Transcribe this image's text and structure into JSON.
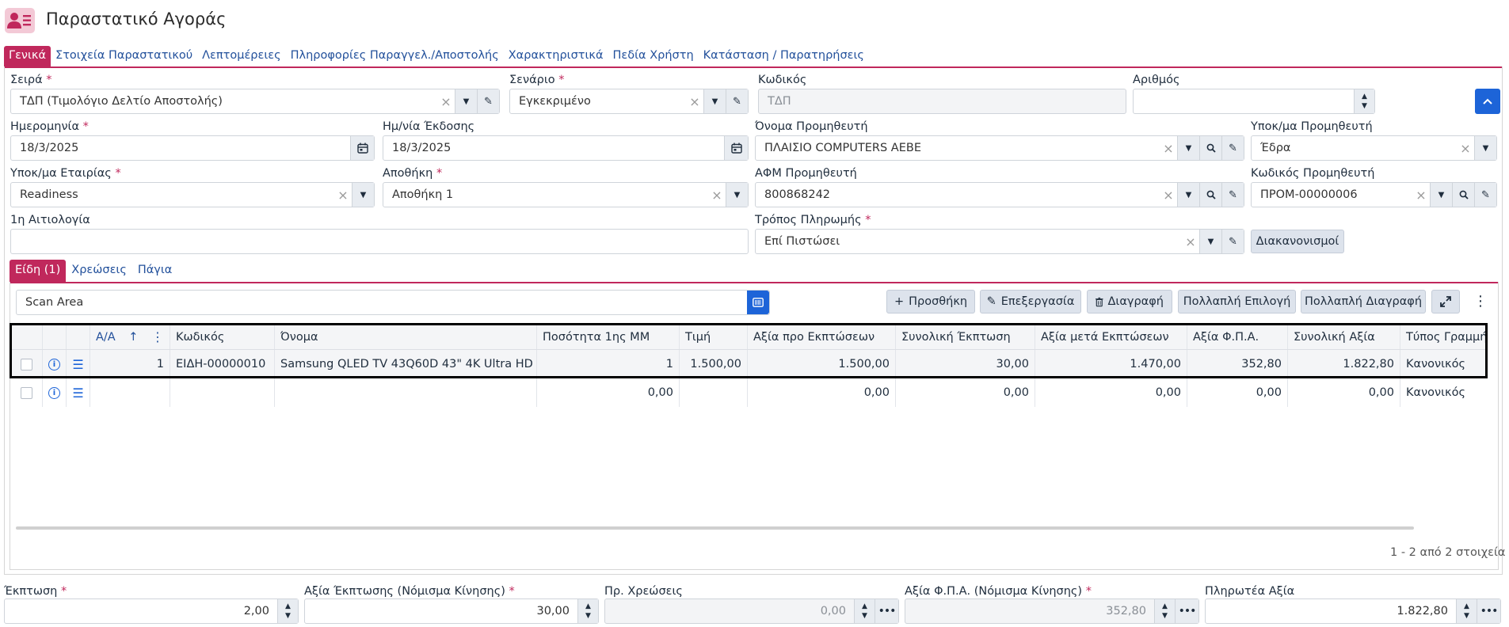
{
  "header": {
    "title": "Παραστατικό Αγοράς",
    "icon": "user-list-icon"
  },
  "tabs": [
    "Γενικά",
    "Στοιχεία Παραστατικού",
    "Λεπτομέρειες",
    "Πληροφορίες Παραγγελ./Αποστολής",
    "Χαρακτηριστικά",
    "Πεδία Χρήστη",
    "Κατάσταση / Παρατηρήσεις"
  ],
  "form": {
    "seira": {
      "label": "Σειρά",
      "value": "ΤΔΠ (Τιμολόγιο Δελτίο Αποστολής)"
    },
    "senario": {
      "label": "Σενάριο",
      "value": "Εγκεκριμένο"
    },
    "kodikos": {
      "label": "Κωδικός",
      "value": "ΤΔΠ"
    },
    "arithmos": {
      "label": "Αριθμός",
      "value": ""
    },
    "imerominia": {
      "label": "Ημερομηνία",
      "value": "18/3/2025"
    },
    "imnia_ekdosis": {
      "label": "Ημ/νία Έκδοσης",
      "value": "18/3/2025"
    },
    "onoma_promitheuti": {
      "label": "Όνομα Προμηθευτή",
      "value": "ΠΛΑΙΣΙΟ COMPUTERS AEBE"
    },
    "ypok_promitheuti": {
      "label": "Υποκ/μα Προμηθευτή",
      "value": "Έδρα"
    },
    "ypok_etairias": {
      "label": "Υποκ/μα Εταιρίας",
      "value": "Readiness"
    },
    "apothiki": {
      "label": "Αποθήκη",
      "value": "Αποθήκη 1"
    },
    "afm_promitheuti": {
      "label": "ΑΦΜ Προμηθευτή",
      "value": "800868242"
    },
    "kodikos_promitheuti": {
      "label": "Κωδικός Προμηθευτή",
      "value": "ΠΡΟΜ-00000006"
    },
    "aitiologia": {
      "label": "1η Αιτιολογία",
      "value": ""
    },
    "tropos_pliromis": {
      "label": "Τρόπος Πληρωμής",
      "value": "Επί Πιστώσει"
    },
    "diakanonismoi_label": "Διακανονισμοί",
    "required_mark": "*"
  },
  "subtabs": [
    "Είδη (1)",
    "Χρεώσεις",
    "Πάγια"
  ],
  "items": {
    "scan_placeholder": "Scan Area",
    "toolbar": {
      "add": "Προσθήκη",
      "edit": "Επεξεργασία",
      "delete": "Διαγραφή",
      "multi_select": "Πολλαπλή Επιλογή",
      "multi_delete": "Πολλαπλή Διαγραφή"
    },
    "columns": [
      "A/A",
      "Κωδικός",
      "Όνομα",
      "Ποσότητα 1ης ΜΜ",
      "Τιμή",
      "Αξία προ Εκπτώσεων",
      "Συνολική Έκπτωση",
      "Αξία μετά Εκπτώσεων",
      "Αξία Φ.Π.Α.",
      "Συνολική Αξία",
      "Τύπος Γραμμής"
    ],
    "rows": [
      [
        "1",
        "ΕΙΔΗ-00000010",
        "Samsung QLED TV 43Q60D 43\" 4K Ultra HD",
        "1",
        "1.500,00",
        "1.500,00",
        "30,00",
        "1.470,00",
        "352,80",
        "1.822,80",
        "Κανονικός"
      ],
      [
        "",
        "",
        "",
        "0,00",
        "",
        "0,00",
        "0,00",
        "0,00",
        "0,00",
        "0,00",
        "Κανονικός"
      ]
    ],
    "pager": "1 - 2 από 2 στοιχεία"
  },
  "footer": {
    "ekptosi": {
      "label": "Έκπτωση",
      "value": "2,00"
    },
    "axia_ekptosis": {
      "label": "Αξία Έκπτωσης (Νόμισμα Κίνησης)",
      "value": "30,00"
    },
    "pr_xreoseis": {
      "label": "Πρ. Χρεώσεις",
      "value": "0,00"
    },
    "axia_fpa": {
      "label": "Αξία Φ.Π.Α. (Νόμισμα Κίνησης)",
      "value": "352,80"
    },
    "pliroteа_axia": {
      "label": "Πληρωτέα Αξία",
      "value": "1.822,80"
    }
  },
  "colors": {
    "accent": "#c0285c",
    "primary": "#1d64d8",
    "link": "#22509b"
  }
}
